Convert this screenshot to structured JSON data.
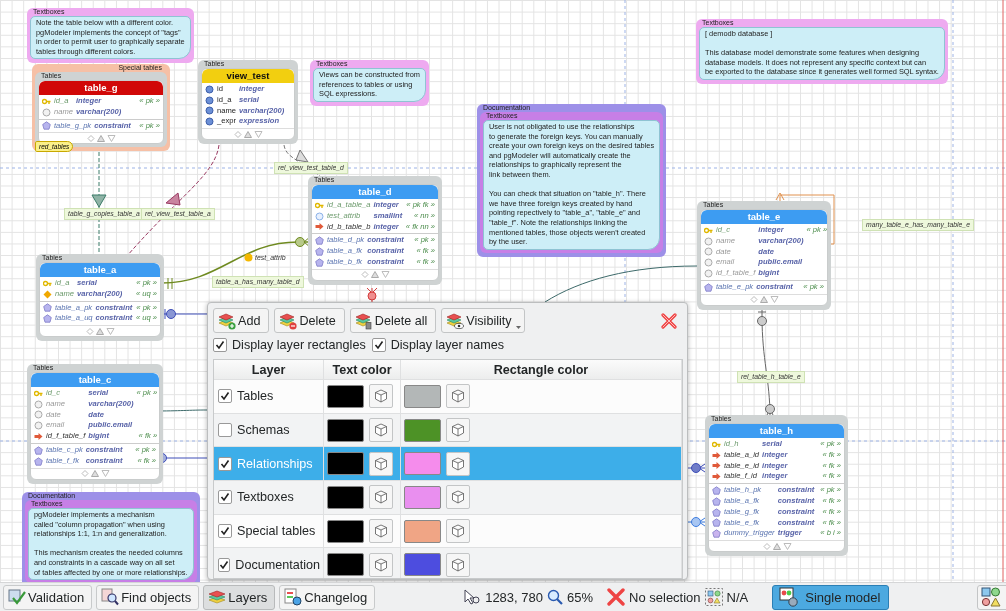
{
  "canvas": {
    "textboxes": [
      {
        "layers": [
          {
            "name": "Textboxes",
            "color": "#eeaaf0"
          }
        ],
        "text": "Note the table below with a different color.\npgModeler implements the concept of \"tags\"\nin order to permit user to graphically separate\ntables through different colors."
      },
      {
        "layers": [
          {
            "name": "Textboxes",
            "color": "#eeaaf0"
          }
        ],
        "text": "Views can be constructed from\nreferences to tables or using\nSQL expressions."
      },
      {
        "layers": [
          {
            "name": "Textboxes",
            "color": "#eeaaf0"
          }
        ],
        "text": "[ demodb database ]\n\nThis database model demonstrate some features when designing\ndatabase models. It does not represent any specific context but can\nbe exported to the database since it generates well formed SQL syntax."
      },
      {
        "layers": [
          {
            "name": "Documentation",
            "color": "#9d90e8"
          },
          {
            "name": "Textboxes",
            "color": "#c77fe6"
          }
        ],
        "text": "User is not obligated to use the relationships\nto generate the foreign keys. You can manually\ncreate your own foreign keys on the desired tables\nand pgModeler will automatically create the\nrelationships to graphically represent the\nlink between them.\n\nYou can check that situation on \"table_h\". There\nwe have three foreign keys created by hand\npointing repectively to \"table_a\", \"table_e\" and\n\"table_f\". Note the relationships linking the\nmentioned tables, those objects weren't created\nby the user."
      },
      {
        "layers": [
          {
            "name": "Documentation",
            "color": "#9d90e8"
          },
          {
            "name": "Textboxes",
            "color": "#c77fe6"
          }
        ],
        "text": "pgModeler implements a mechanism\ncalled \"column propagation\" when using\nrelationships 1:1, 1:n and generalization.\n\nThis mechanism creates the needed columns\nand constraints in a cascade way on all set\nof tables affected by one or more relationships."
      }
    ],
    "tables": [
      {
        "title": "table_g",
        "color": "#d10808",
        "layers": [
          {
            "name": "Special tables",
            "color": "#f6c0a6"
          },
          {
            "name": "Tables",
            "color": "#cfd3d3"
          }
        ],
        "tag": "red_tables",
        "columns": [
          {
            "kind": "pk",
            "name": "id_a",
            "type": "integer",
            "tag": "« pk »"
          },
          {
            "kind": "plain",
            "name": "name",
            "type": "varchar(200)"
          }
        ],
        "constraints": [
          {
            "kind": "constraint",
            "name": "table_g_pk",
            "type": "constraint",
            "tag": "« pk »"
          }
        ]
      },
      {
        "title": "view_test",
        "color": "#f2cf10",
        "layers": [
          {
            "name": "Tables",
            "color": "#cfd3d3"
          }
        ],
        "columns": [
          {
            "kind": "view",
            "name": "id",
            "type": "integer"
          },
          {
            "kind": "view",
            "name": "id_a",
            "type": "serial"
          },
          {
            "kind": "view",
            "name": "name",
            "type": "varchar(200)"
          },
          {
            "kind": "view",
            "name": "_expr",
            "type": "expression"
          }
        ]
      },
      {
        "title": "table_d",
        "color": "#3d9cf2",
        "layers": [
          {
            "name": "Tables",
            "color": "#cfd3d3"
          }
        ],
        "columns": [
          {
            "kind": "pk",
            "name": "id_a_table_a",
            "type": "integer",
            "tag": "« pk fk »"
          },
          {
            "kind": "nn",
            "name": "test_attrib",
            "type": "smallint",
            "tag": "« nn »"
          },
          {
            "kind": "fk",
            "name": "id_b_table_b",
            "type": "integer",
            "tag": "« fk nn »"
          }
        ],
        "constraints": [
          {
            "kind": "constraint",
            "name": "table_d_pk",
            "type": "constraint",
            "tag": "« pk »"
          },
          {
            "kind": "constraint",
            "name": "table_a_fk",
            "type": "constraint",
            "tag": "« fk »"
          },
          {
            "kind": "constraint",
            "name": "table_b_fk",
            "type": "constraint",
            "tag": "« fk »"
          }
        ]
      },
      {
        "title": "table_a",
        "color": "#3d9cf2",
        "layers": [
          {
            "name": "Tables",
            "color": "#cfd3d3"
          }
        ],
        "columns": [
          {
            "kind": "pk",
            "name": "id_a",
            "type": "serial",
            "tag": "« pk »"
          },
          {
            "kind": "uq",
            "name": "name",
            "type": "varchar(200)",
            "tag": "« uq »"
          }
        ],
        "constraints": [
          {
            "kind": "constraint",
            "name": "table_a_pk",
            "type": "constraint",
            "tag": "« pk »"
          },
          {
            "kind": "constraint",
            "name": "table_a_uq",
            "type": "constraint",
            "tag": "« uq »"
          }
        ]
      },
      {
        "title": "table_e",
        "color": "#3d9cf2",
        "layers": [
          {
            "name": "Tables",
            "color": "#cfd3d3"
          }
        ],
        "columns": [
          {
            "kind": "pk",
            "name": "id_c",
            "type": "integer",
            "tag": "« pk »"
          },
          {
            "kind": "plain",
            "name": "name",
            "type": "varchar(200)"
          },
          {
            "kind": "plain",
            "name": "date",
            "type": "date"
          },
          {
            "kind": "plain",
            "name": "email",
            "type": "public.email"
          },
          {
            "kind": "plain",
            "name": "id_f_table_f",
            "type": "bigint"
          }
        ],
        "constraints": [
          {
            "kind": "constraint",
            "name": "table_e_pk",
            "type": "constraint",
            "tag": "« pk »"
          }
        ]
      },
      {
        "title": "table_c",
        "color": "#3d9cf2",
        "layers": [
          {
            "name": "Tables",
            "color": "#cfd3d3"
          }
        ],
        "columns": [
          {
            "kind": "pk",
            "name": "id_c",
            "type": "serial",
            "tag": "« pk »"
          },
          {
            "kind": "plain",
            "name": "name",
            "type": "varchar(200)"
          },
          {
            "kind": "plain",
            "name": "date",
            "type": "date"
          },
          {
            "kind": "plain",
            "name": "email",
            "type": "public.email"
          },
          {
            "kind": "fk",
            "name": "id_f_table_f",
            "type": "bigint",
            "tag": "« fk »"
          }
        ],
        "constraints": [
          {
            "kind": "constraint",
            "name": "table_c_pk",
            "type": "constraint",
            "tag": "« pk »"
          },
          {
            "kind": "constraint",
            "name": "table_f_fk",
            "type": "constraint",
            "tag": "« fk »"
          }
        ]
      },
      {
        "title": "table_h",
        "color": "#3d9cf2",
        "layers": [
          {
            "name": "Tables",
            "color": "#cfd3d3"
          }
        ],
        "columns": [
          {
            "kind": "pk",
            "name": "id_h",
            "type": "serial",
            "tag": "« pk »"
          },
          {
            "kind": "fk",
            "name": "table_a_id",
            "type": "integer",
            "tag": "« fk »"
          },
          {
            "kind": "fk",
            "name": "table_e_id",
            "type": "integer",
            "tag": "« fk »"
          },
          {
            "kind": "fk",
            "name": "table_f_id",
            "type": "integer",
            "tag": "« fk »"
          }
        ],
        "constraints": [
          {
            "kind": "constraint",
            "name": "table_h_pk",
            "type": "constraint",
            "tag": "« pk »"
          },
          {
            "kind": "constraint",
            "name": "table_a_fk",
            "type": "constraint",
            "tag": "« fk »"
          },
          {
            "kind": "constraint",
            "name": "table_g_fk",
            "type": "constraint",
            "tag": "« fk »"
          },
          {
            "kind": "constraint",
            "name": "table_e_fk",
            "type": "constraint",
            "tag": "« fk »"
          },
          {
            "kind": "trigger",
            "name": "dummy_trigger",
            "type": "trigger",
            "tag": "« b i »"
          }
        ]
      }
    ],
    "relationship_labels": [
      {
        "kind": "relationship",
        "text": "table_g_copies_table_a"
      },
      {
        "kind": "relationship",
        "text": "rel_view_test_table_a"
      },
      {
        "kind": "relationship",
        "text": "rel_view_test_table_d"
      },
      {
        "kind": "attribute",
        "text": "test_attrib"
      },
      {
        "kind": "relationship",
        "text": "table_a_has_many_table_d"
      },
      {
        "kind": "relationship",
        "text": "many_table_e_has_many_table_e"
      },
      {
        "kind": "relationship",
        "text": "rel_table_h_table_e"
      }
    ]
  },
  "layers_panel": {
    "buttons": [
      {
        "label": "Add",
        "menu": false
      },
      {
        "label": "Delete",
        "menu": false
      },
      {
        "label": "Delete all",
        "menu": false
      },
      {
        "label": "Visibility",
        "menu": true
      }
    ],
    "options": [
      {
        "label": "Display layer rectangles",
        "checked": true
      },
      {
        "label": "Display layer names",
        "checked": true
      }
    ],
    "columns": [
      "Layer",
      "Text color",
      "Rectangle color"
    ],
    "rows": [
      {
        "name": "Tables",
        "visible": true,
        "selected": false,
        "swatches": [
          {
            "color": "#000000"
          },
          {
            "color": "#b3b7b7"
          }
        ]
      },
      {
        "name": "Schemas",
        "visible": false,
        "selected": false,
        "swatches": [
          {
            "color": "#000000"
          },
          {
            "color": "#4d9226"
          }
        ]
      },
      {
        "name": "Relationships",
        "visible": true,
        "selected": true,
        "swatches": [
          {
            "color": "#000000"
          },
          {
            "color": "#f58cec"
          }
        ]
      },
      {
        "name": "Textboxes",
        "visible": true,
        "selected": false,
        "swatches": [
          {
            "color": "#000000"
          },
          {
            "color": "#e98fef"
          }
        ]
      },
      {
        "name": "Special tables",
        "visible": true,
        "selected": false,
        "swatches": [
          {
            "color": "#000000"
          },
          {
            "color": "#f0a585"
          }
        ]
      },
      {
        "name": "Documentation",
        "visible": true,
        "selected": false,
        "swatches": [
          {
            "color": "#000000"
          },
          {
            "color": "#4d4ddf"
          }
        ]
      }
    ]
  },
  "status_bar": {
    "buttons": [
      {
        "label": "Validation",
        "selected": false
      },
      {
        "label": "Find objects",
        "selected": false
      },
      {
        "label": "Layers",
        "selected": true
      },
      {
        "label": "Changelog",
        "selected": false
      }
    ],
    "position": "1283, 780",
    "zoom": "65%",
    "selection": "No selection",
    "object_count": "N/A",
    "mode": {
      "label": "Single model",
      "selected": true
    }
  }
}
